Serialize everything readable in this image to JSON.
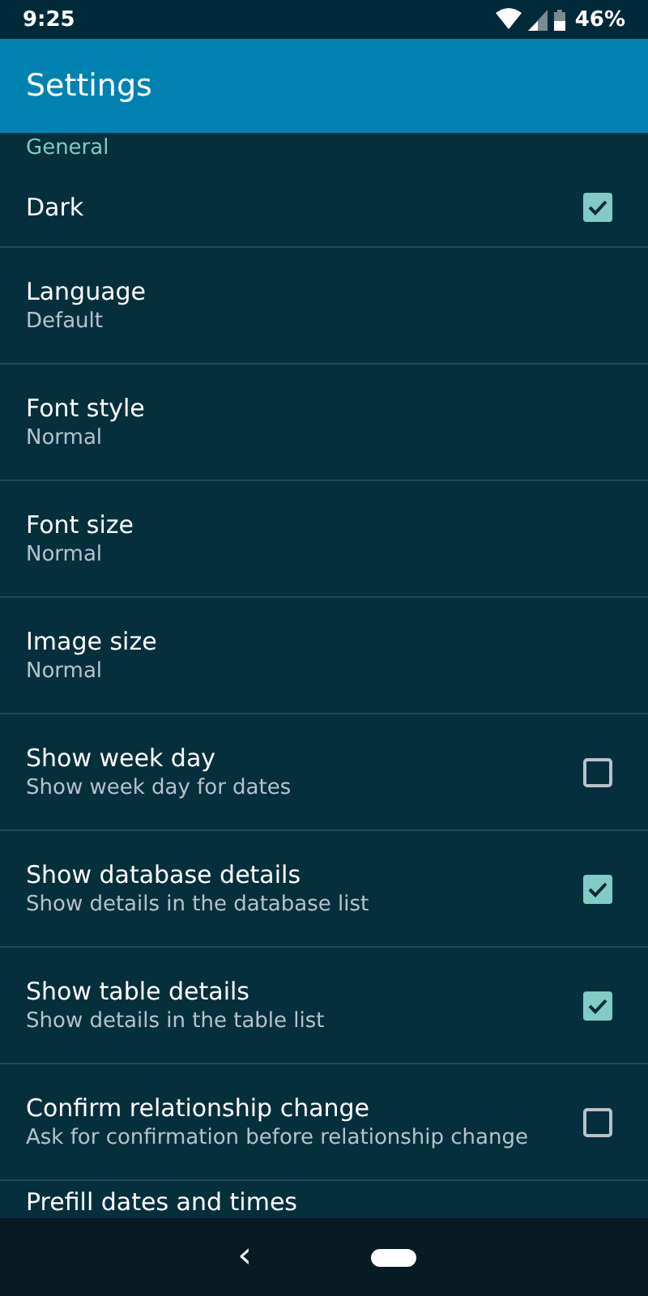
{
  "status_bar": {
    "time": "9:25",
    "battery": "46%"
  },
  "app_bar": {
    "title": "Settings"
  },
  "section": {
    "title": "General"
  },
  "settings": [
    {
      "kind": "checkbox",
      "title": "Dark",
      "checked": true
    },
    {
      "kind": "list",
      "title": "Language",
      "summary": "Default"
    },
    {
      "kind": "list",
      "title": "Font style",
      "summary": "Normal"
    },
    {
      "kind": "list",
      "title": "Font size",
      "summary": "Normal"
    },
    {
      "kind": "list",
      "title": "Image size",
      "summary": "Normal"
    },
    {
      "kind": "checkbox",
      "title": "Show week day",
      "summary": "Show week day for dates",
      "checked": false
    },
    {
      "kind": "checkbox",
      "title": "Show database details",
      "summary": "Show details in the database list",
      "checked": true
    },
    {
      "kind": "checkbox",
      "title": "Show table details",
      "summary": "Show details in the table list",
      "checked": true
    },
    {
      "kind": "checkbox",
      "title": "Confirm relationship change",
      "summary": "Ask for confirmation before relationship change",
      "checked": false
    },
    {
      "kind": "list",
      "title": "Prefill dates and times"
    }
  ],
  "nav_bar": {
    "back": "‹"
  }
}
